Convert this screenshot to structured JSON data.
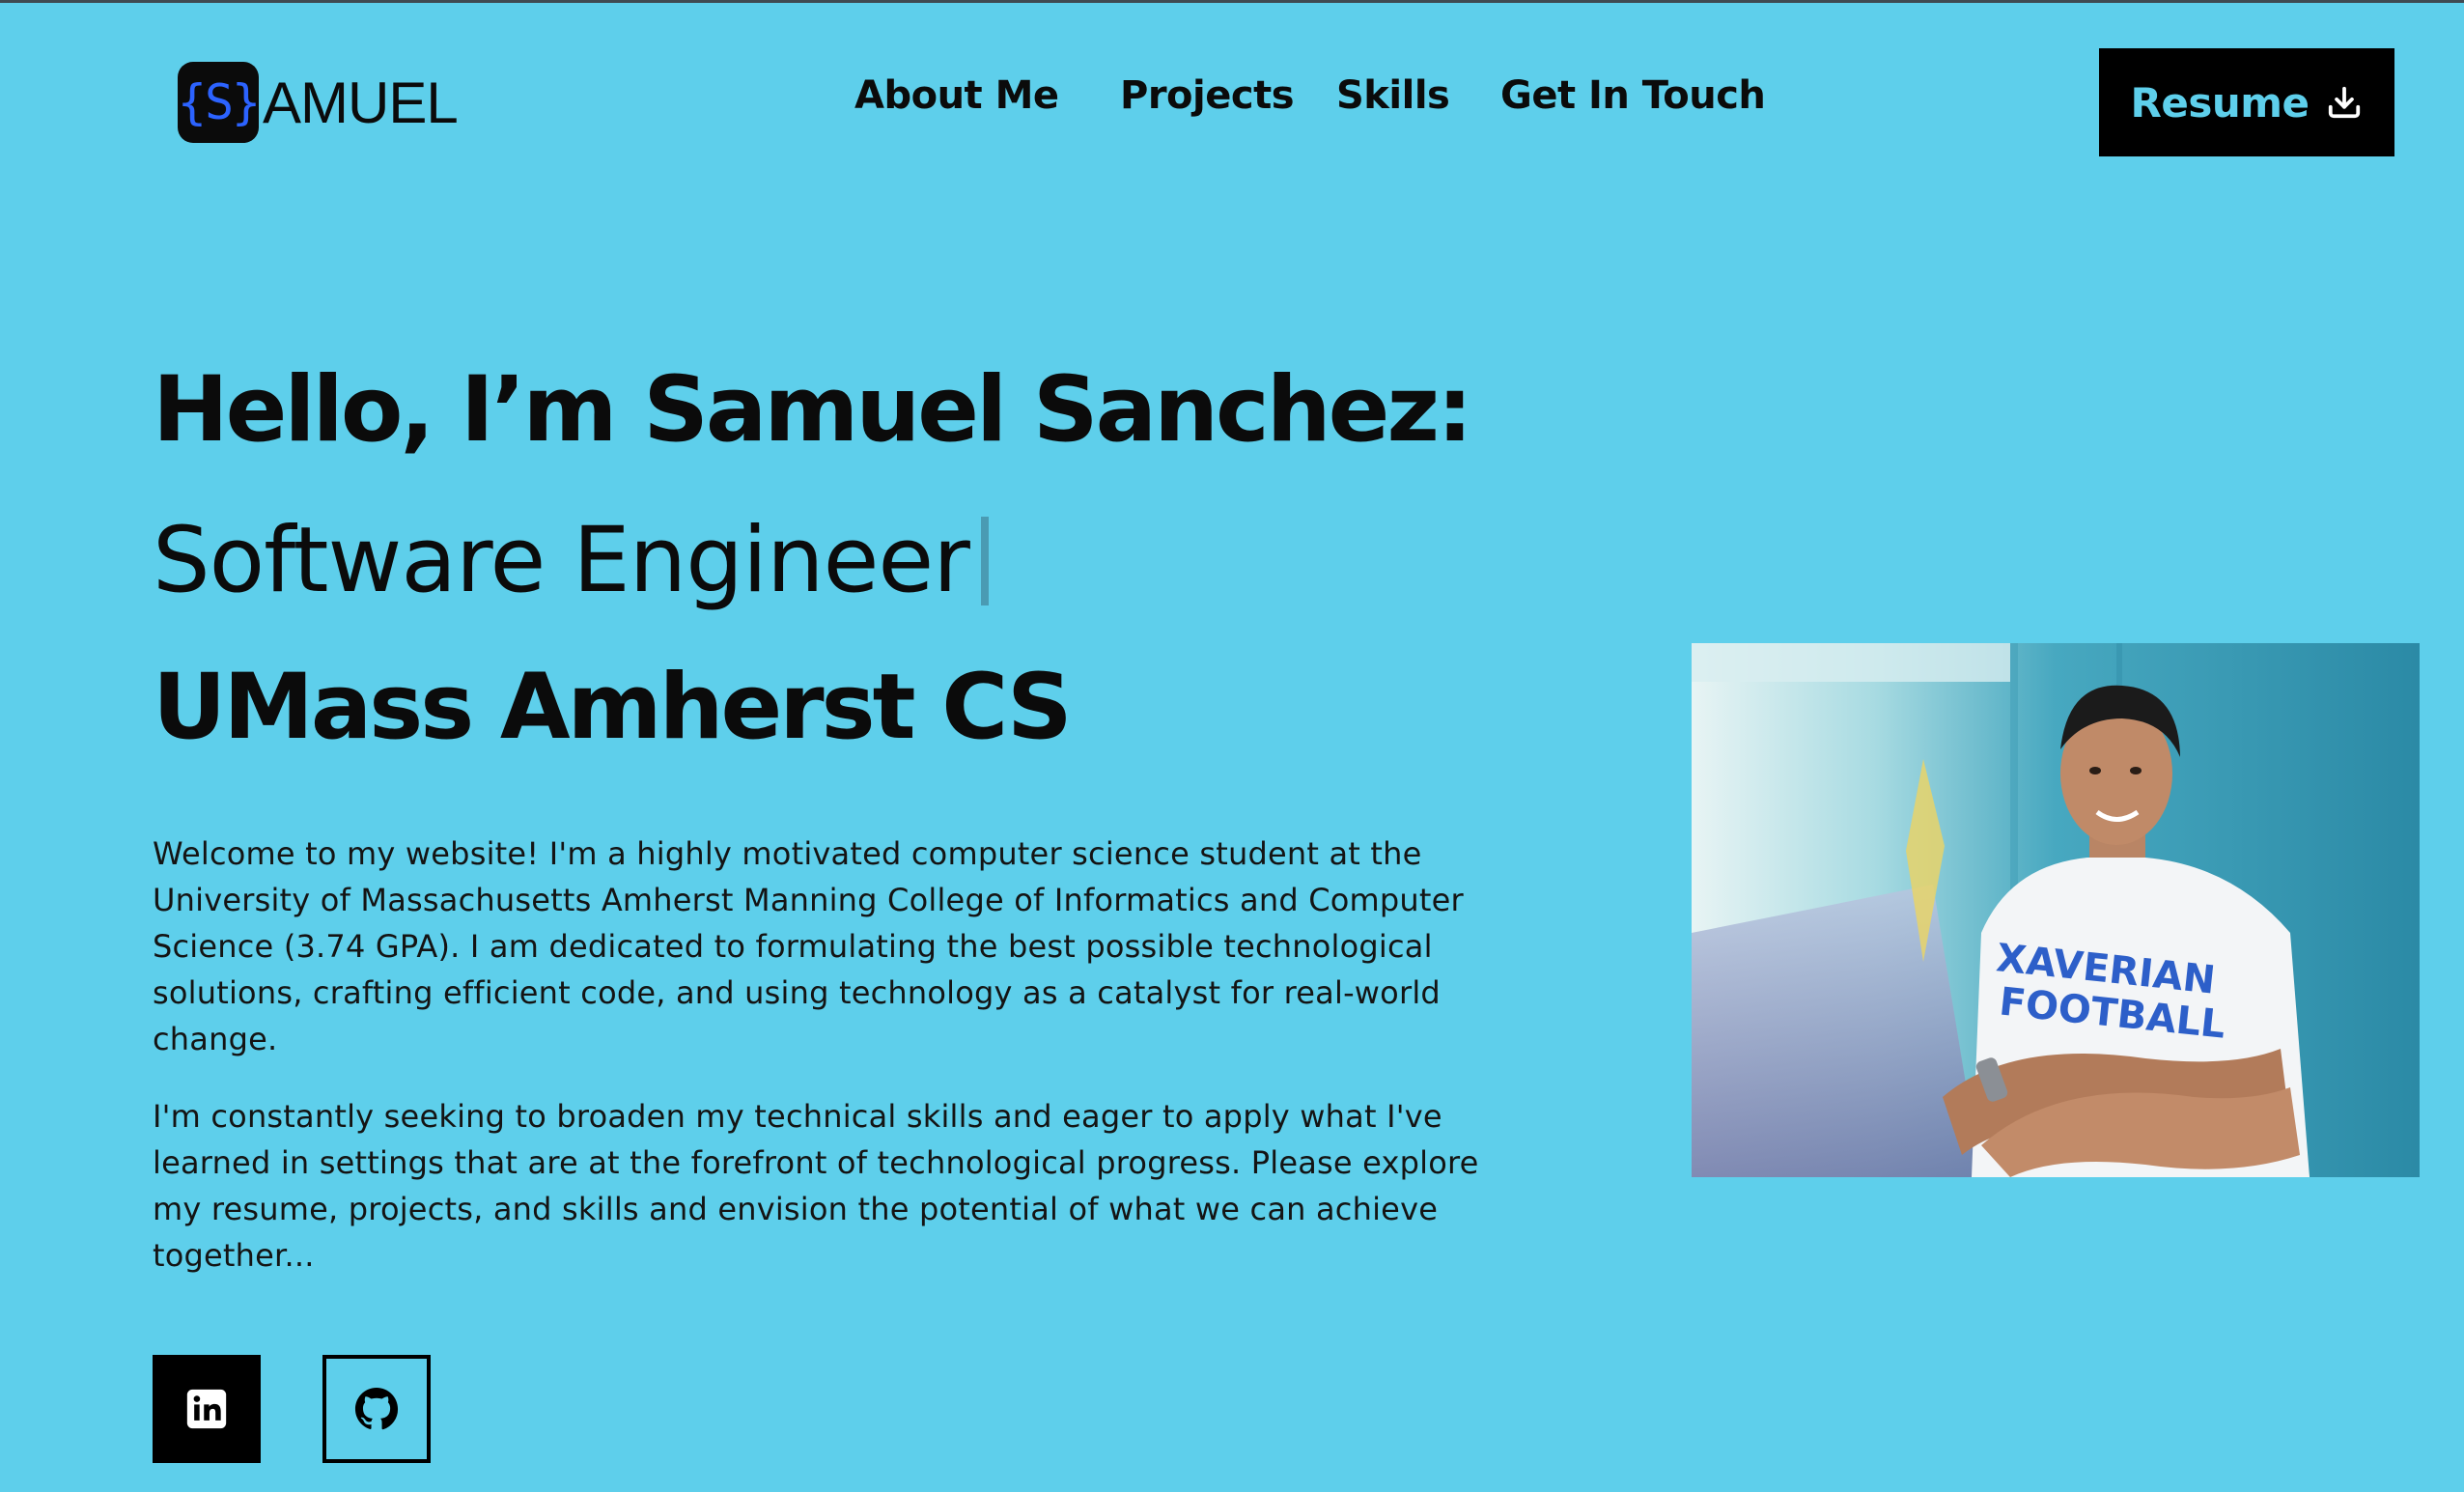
{
  "header": {
    "logo_mark": "{S}",
    "logo_text": "AMUEL",
    "nav": [
      "About Me",
      "Projects",
      "Skills",
      "Get In Touch"
    ],
    "resume_label": "Resume",
    "resume_icon": "download-icon"
  },
  "hero": {
    "greeting": "Hello, I’m Samuel Sanchez:",
    "role": "Software Engineer",
    "school": "UMass Amherst CS",
    "paragraphs": [
      "Welcome to my website! I'm a highly motivated computer science student at the University of Massachusetts Amherst Manning College of Informatics and Computer Science (3.74 GPA). I am dedicated to formulating the best possible technological solutions, crafting efficient code, and using technology as a catalyst for real-world change.",
      "I'm constantly seeking to broaden my technical skills and eager to apply what I've learned in settings that are at the forefront of technological progress. Please explore my resume, projects, and skills and envision the potential of what we can achieve together..."
    ]
  },
  "photo": {
    "shirt_text_line1": "XAVERIAN",
    "shirt_text_line2": "FOOTBALL"
  },
  "social": {
    "linkedin_icon": "linkedin-icon",
    "github_icon": "github-icon"
  },
  "colors": {
    "background": "#5ecfeb",
    "logo_accent": "#2c63ff",
    "button_bg": "#000000",
    "button_text": "#5ecfeb"
  }
}
